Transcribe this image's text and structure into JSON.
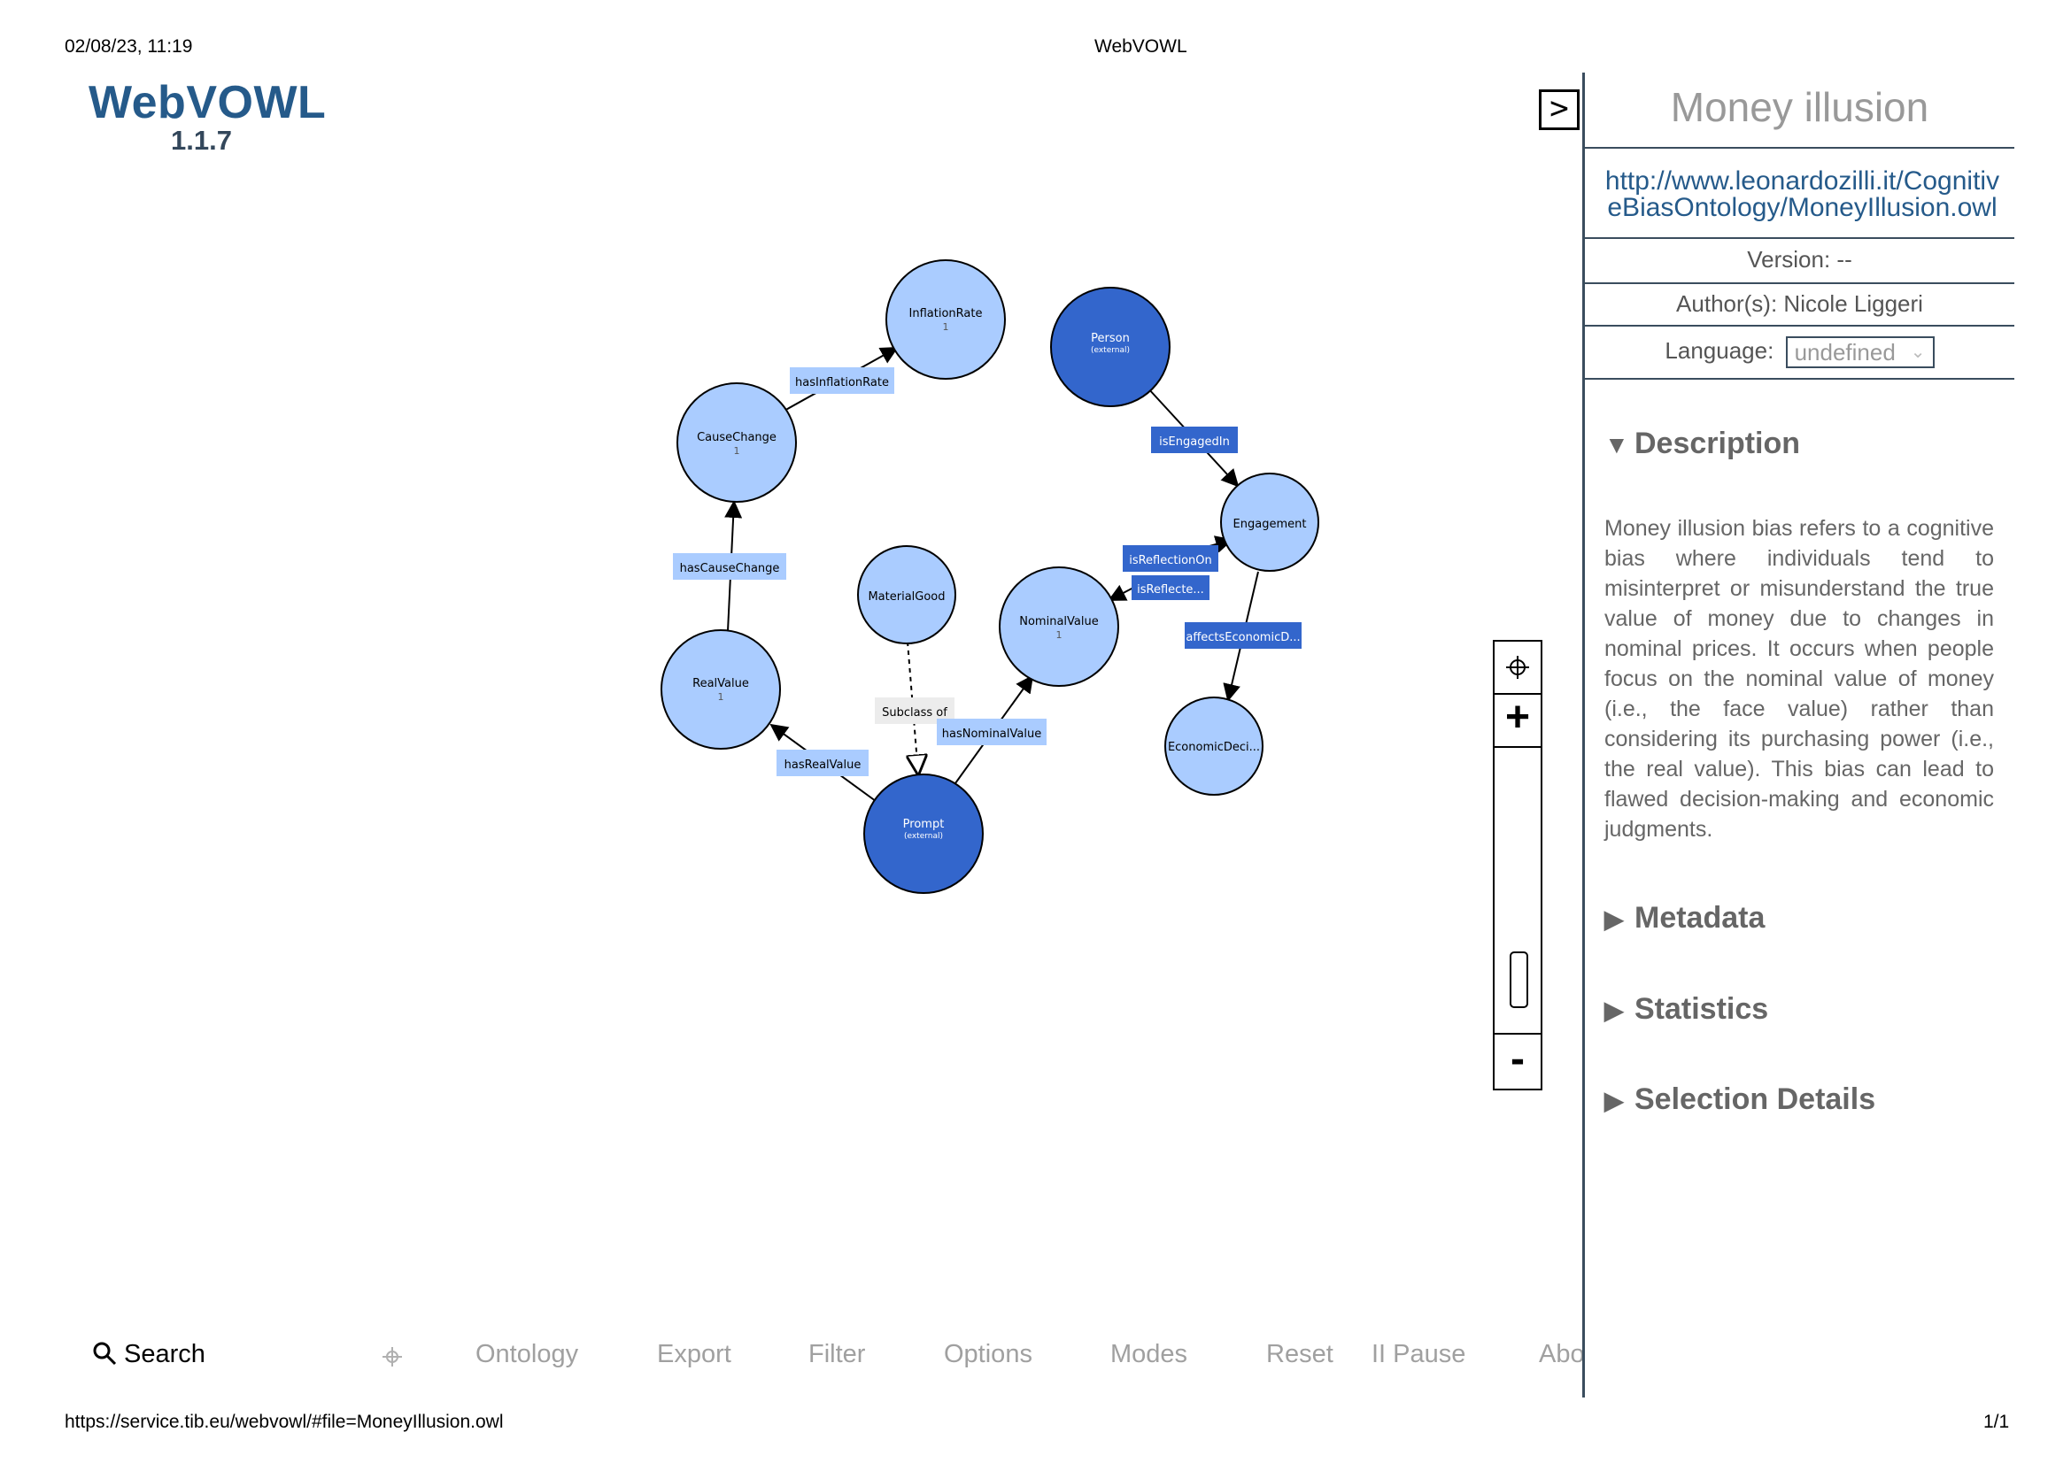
{
  "print_header": {
    "datetime": "02/08/23, 11:19",
    "page_title": "WebVOWL"
  },
  "print_footer": {
    "url": "https://service.tib.eu/webvowl/#file=MoneyIllusion.owl",
    "page": "1/1"
  },
  "logo": {
    "title": "WebVOWL",
    "version": "1.1.7"
  },
  "graph": {
    "nodes": {
      "inflation_rate": {
        "label": "InflationRate",
        "count": "1"
      },
      "cause_change": {
        "label": "CauseChange",
        "count": "1"
      },
      "real_value": {
        "label": "RealValue",
        "count": "1"
      },
      "material_good": {
        "label": "MaterialGood"
      },
      "nominal_value": {
        "label": "NominalValue",
        "count": "1"
      },
      "person": {
        "label": "Person",
        "sub": "(external)"
      },
      "engagement": {
        "label": "Engagement"
      },
      "economic_deci": {
        "label": "EconomicDeci..."
      },
      "prompt": {
        "label": "Prompt",
        "sub": "(external)"
      }
    },
    "properties": {
      "has_inflation_rate": "hasInflationRate",
      "has_cause_change": "hasCauseChange",
      "has_real_value": "hasRealValue",
      "has_nominal_value": "hasNominalValue",
      "subclass_of": "Subclass of",
      "is_engaged_in": "isEngagedIn",
      "is_reflection_on": "isReflectionOn",
      "is_reflecte": "isReflecte...",
      "affects_economic": "affectsEconomicD..."
    },
    "colors": {
      "class_light": "#aaccff",
      "class_external": "#3366cc",
      "property_light": "#aaccff",
      "property_dark": "#3366cc"
    }
  },
  "sidebar": {
    "toggle_label": ">",
    "title": "Money illusion",
    "iri": "http://www.leonardozilli.it/CognitiveBiasOntology/MoneyIllusion.owl",
    "version": "Version: --",
    "authors": "Author(s): Nicole Liggeri",
    "language_label": "Language:",
    "language_value": "undefined",
    "sections": {
      "description": {
        "title": "Description",
        "expanded": true
      },
      "metadata": {
        "title": "Metadata",
        "expanded": false
      },
      "statistics": {
        "title": "Statistics",
        "expanded": false
      },
      "selection_details": {
        "title": "Selection Details",
        "expanded": false
      }
    },
    "description_text": "Money illusion bias refers to a cognitive bias where individuals tend to misinterpret or misunderstand the true value of money due to changes in nominal prices. It occurs when people focus on the nominal value of money (i.e., the face value) rather than considering its purchasing power (i.e., the real value). This bias can lead to flawed decision-making and economic judgments."
  },
  "zoom": {
    "in_label": "+",
    "out_label": "-"
  },
  "bottom_menu": {
    "search": "Search",
    "ontology": "Ontology",
    "export": "Export",
    "filter": "Filter",
    "options": "Options",
    "modes": "Modes",
    "reset": "Reset",
    "pause": "II Pause",
    "about": "Abo"
  }
}
